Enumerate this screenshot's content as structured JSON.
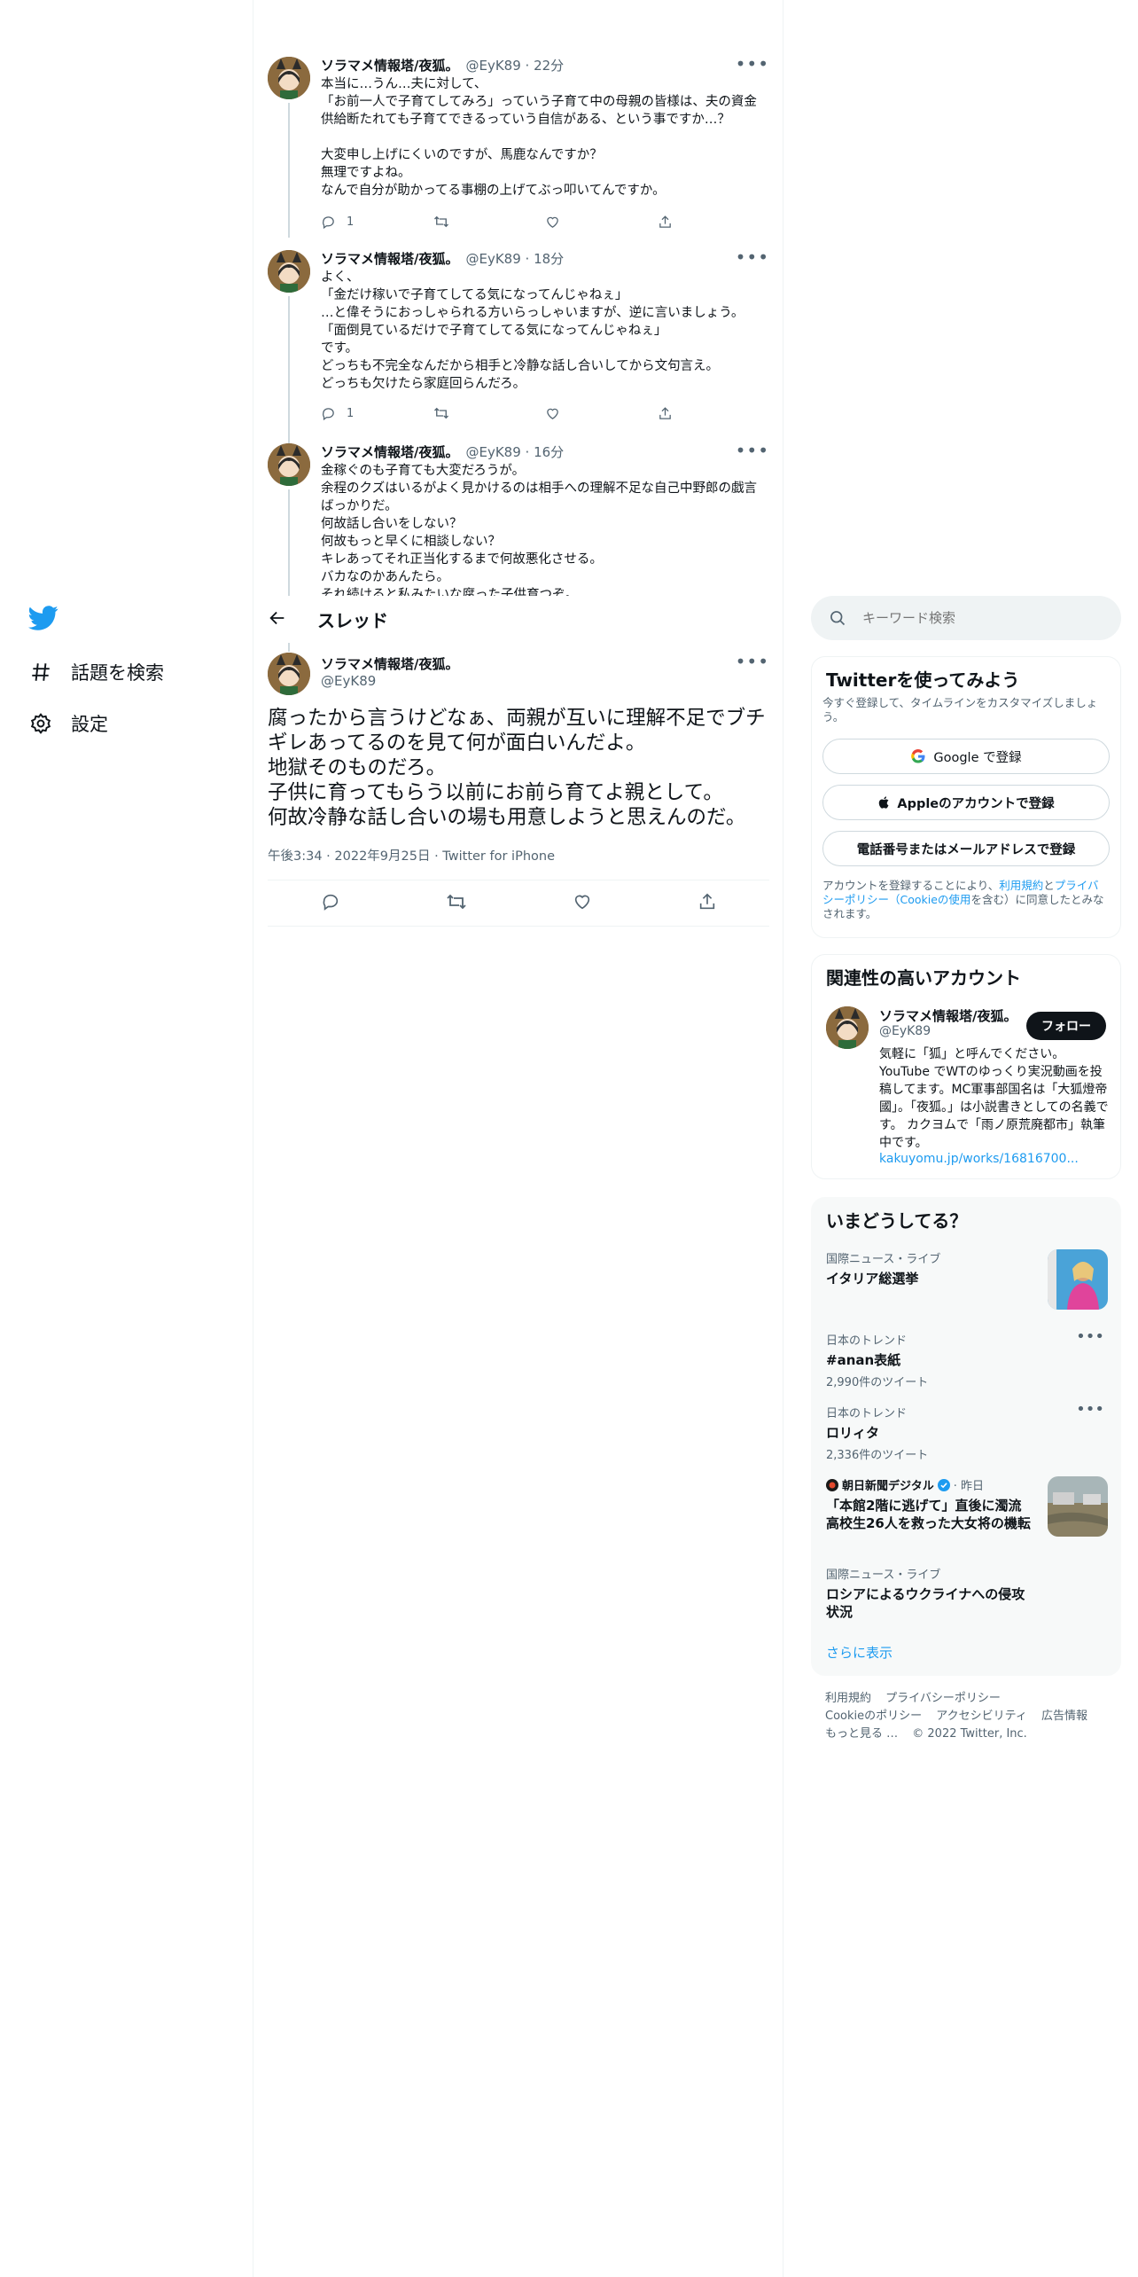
{
  "nav": {
    "explore_label": "話題を検索",
    "settings_label": "設定"
  },
  "thread_tweets": [
    {
      "name": "ソラマメ情報塔/夜狐。",
      "handle": "@EyK89 · 22分",
      "text": "本当に…うん…夫に対して、\n「お前一人で子育てしてみろ」っていう子育て中の母親の皆様は、夫の資金供給断たれても子育てできるっていう自信がある、という事ですか…？\n\n大変申し上げにくいのですが、馬鹿なんですか？\n無理ですよね。\nなんで自分が助かってる事棚の上げてぶっ叩いてんですか。",
      "reply_count": "1"
    },
    {
      "name": "ソラマメ情報塔/夜狐。",
      "handle": "@EyK89 · 18分",
      "text": "よく、\n「金だけ稼いで子育てしてる気になってんじゃねぇ」\n…と偉そうにおっしゃられる方いらっしゃいますが、逆に言いましょう。\n「面倒見ているだけで子育てしてる気になってんじゃねぇ」\nです。\nどっちも不完全なんだから相手と冷静な話し合いしてから文句言え。\nどっちも欠けたら家庭回らんだろ。",
      "reply_count": "1"
    },
    {
      "name": "ソラマメ情報塔/夜狐。",
      "handle": "@EyK89 · 16分",
      "text": "金稼ぐのも子育ても大変だろうが。\n余程のクズはいるがよく見かけるのは相手への理解不足な自己中野郎の戯言ばっかりだ。\n何故話し合いをしない？\n何故もっと早くに相談しない？\nキレあってそれ正当化するまで何故悪化させる。\nバカなのかあんたら。\nそれ続けると私みたいな腐った子供育つぞ。",
      "reply_count": ""
    }
  ],
  "header": {
    "title": "スレッド"
  },
  "main_tweet": {
    "name": "ソラマメ情報塔/夜狐。",
    "handle": "@EyK89",
    "text": "腐ったから言うけどなぁ、両親が互いに理解不足でブチギレあってるのを見て何が面白いんだよ。\n地獄そのものだろ。\n子供に育ってもらう以前にお前ら育てよ親として。\n何故冷静な話し合いの場も用意しようと思えんのだ。",
    "meta": "午後3:34 · 2022年9月25日 · Twitter for iPhone"
  },
  "search": {
    "placeholder": "キーワード検索"
  },
  "signup": {
    "title": "Twitterを使ってみよう",
    "subtitle": "今すぐ登録して、タイムラインをカスタマイズしましょう。",
    "google_label": "Google で登録",
    "apple_label": "Appleのアカウントで登録",
    "phone_label": "電話番号またはメールアドレスで登録",
    "terms_prefix": "アカウントを登録することにより、",
    "terms_link": "利用規約",
    "terms_and": "と",
    "privacy_link": "プライバシーポリシー（Cookieの使用",
    "terms_suffix": "を含む）に同意したとみなされます。"
  },
  "related": {
    "title": "関連性の高いアカウント",
    "name": "ソラマメ情報塔/夜狐。",
    "handle": "@EyK89",
    "follow_label": "フォロー",
    "bio": "気軽に「狐」と呼んでください。YouTube でWTのゆっくり実況動画を投稿してます。MC軍事部国名は「大狐燈帝國」。「夜狐。」は小説書きとしての名義です。 カクヨムで「雨ノ原荒廃都市」執筆中です。",
    "link": "kakuyomu.jp/works/16816700..."
  },
  "trends": {
    "title": "いまどうしてる？",
    "items": [
      {
        "meta": "国際ニュース・ライブ",
        "title": "イタリア総選挙",
        "count": ""
      },
      {
        "meta": "日本のトレンド",
        "title": "#anan表紙",
        "count": "2,990件のツイート"
      },
      {
        "meta": "日本のトレンド",
        "title": "ロリィタ",
        "count": "2,336件のツイート"
      },
      {
        "meta": "朝日新聞デジタル",
        "meta_suffix": "· 昨日",
        "title": "「本館2階に逃げて」直後に濁流 高校生26人を救った大女将の機転",
        "count": ""
      },
      {
        "meta": "国際ニュース・ライブ",
        "title": "ロシアによるウクライナへの侵攻状況",
        "count": ""
      }
    ],
    "show_more": "さらに表示"
  },
  "footer": {
    "terms": "利用規約",
    "privacy": "プライバシーポリシー",
    "cookie": "Cookieのポリシー",
    "accessibility": "アクセシビリティ",
    "ads": "広告情報",
    "more": "もっと見る …",
    "copyright": "© 2022 Twitter, Inc."
  },
  "colors": {
    "twitter_blue": "#1d9bf0",
    "text": "#0f1419",
    "muted": "#536471",
    "border": "#eff3f4"
  }
}
